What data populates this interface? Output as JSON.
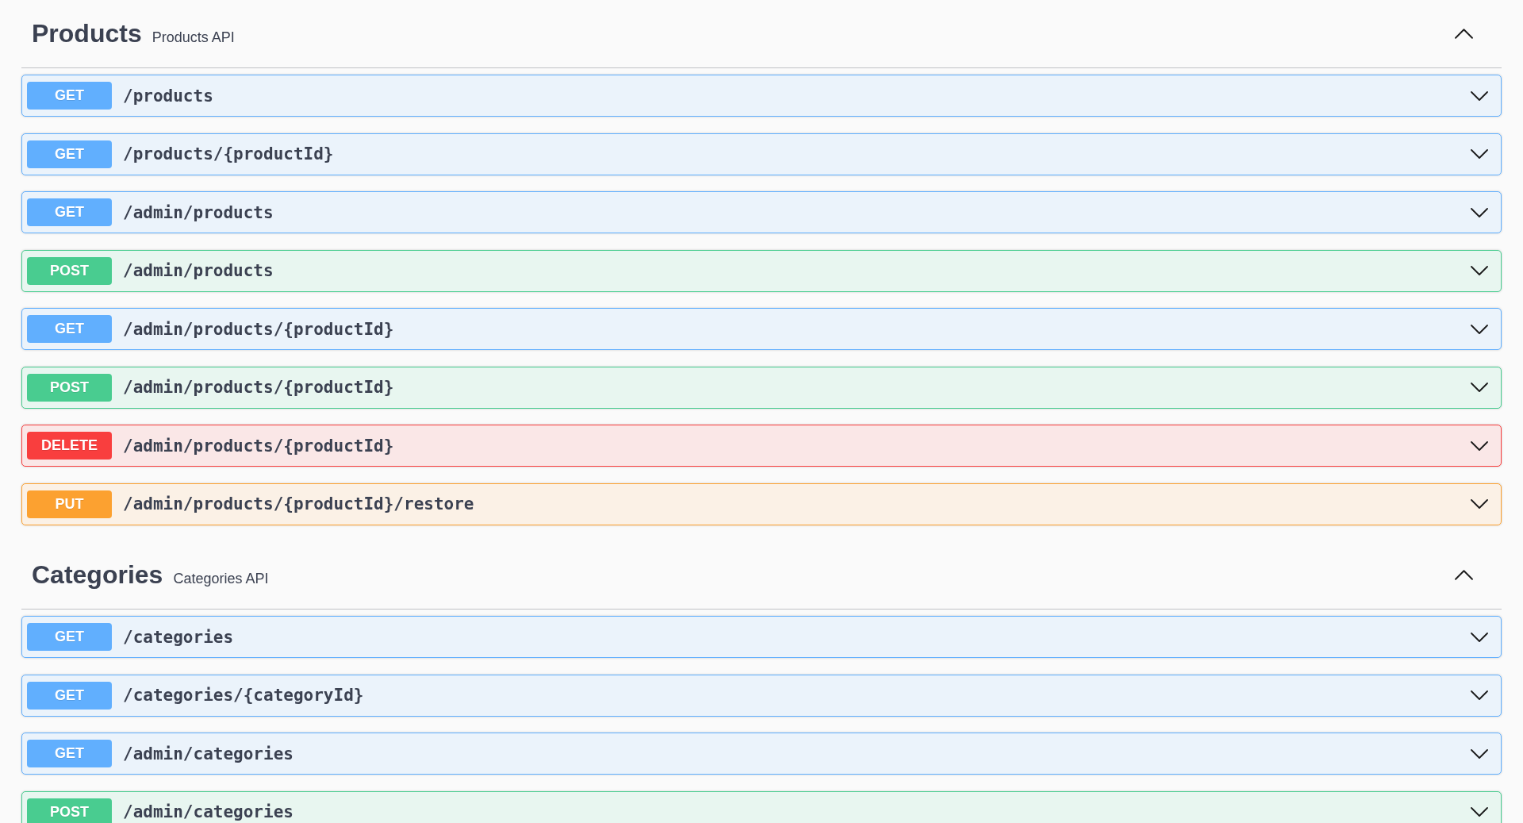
{
  "sections": [
    {
      "title": "Products",
      "description": "Products API",
      "expanded": true,
      "operations": [
        {
          "kind": "get",
          "method": "GET",
          "path": "/products",
          "expanded": false
        },
        {
          "kind": "get",
          "method": "GET",
          "path": "/products/{productId}",
          "expanded": false
        },
        {
          "kind": "get",
          "method": "GET",
          "path": "/admin/products",
          "expanded": false
        },
        {
          "kind": "post",
          "method": "POST",
          "path": "/admin/products",
          "expanded": false
        },
        {
          "kind": "get",
          "method": "GET",
          "path": "/admin/products/{productId}",
          "expanded": false
        },
        {
          "kind": "post",
          "method": "POST",
          "path": "/admin/products/{productId}",
          "expanded": false
        },
        {
          "kind": "delete",
          "method": "DELETE",
          "path": "/admin/products/{productId}",
          "expanded": false
        },
        {
          "kind": "put",
          "method": "PUT",
          "path": "/admin/products/{productId}/restore",
          "expanded": false
        }
      ]
    },
    {
      "title": "Categories",
      "description": "Categories API",
      "expanded": true,
      "operations": [
        {
          "kind": "get",
          "method": "GET",
          "path": "/categories",
          "expanded": false
        },
        {
          "kind": "get",
          "method": "GET",
          "path": "/categories/{categoryId}",
          "expanded": false
        },
        {
          "kind": "get",
          "method": "GET",
          "path": "/admin/categories",
          "expanded": false
        },
        {
          "kind": "post",
          "method": "POST",
          "path": "/admin/categories",
          "expanded": false
        }
      ]
    }
  ]
}
